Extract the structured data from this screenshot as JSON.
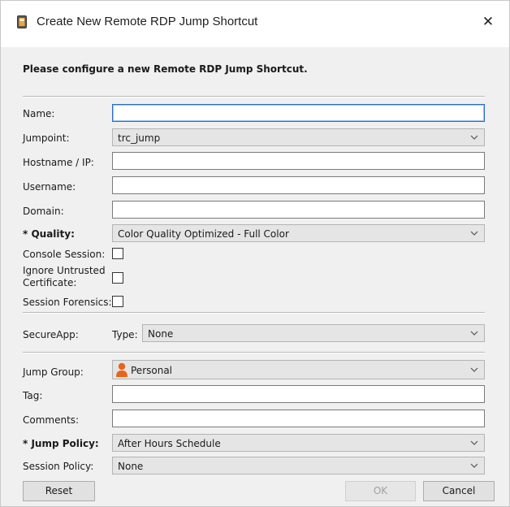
{
  "window": {
    "title": "Create New Remote RDP Jump Shortcut",
    "close_glyph": "✕"
  },
  "heading": "Please configure a new Remote RDP Jump Shortcut.",
  "fields": {
    "name": {
      "label": "Name:",
      "value": ""
    },
    "jumpoint": {
      "label": "Jumpoint:",
      "value": "trc_jump"
    },
    "hostname": {
      "label": "Hostname / IP:",
      "value": ""
    },
    "username": {
      "label": "Username:",
      "value": ""
    },
    "domain": {
      "label": "Domain:",
      "value": ""
    },
    "quality": {
      "label": "* Quality:",
      "value": "Color Quality Optimized - Full Color"
    },
    "console_session": {
      "label": "Console Session:",
      "checked": false
    },
    "ignore_cert": {
      "label_line1": "Ignore Untrusted",
      "label_line2": "Certificate:",
      "checked": false
    },
    "session_forensics": {
      "label": "Session Forensics:",
      "checked": false
    },
    "secureapp": {
      "label": "SecureApp:",
      "type_label": "Type:",
      "type_value": "None"
    },
    "jump_group": {
      "label": "Jump Group:",
      "value": "Personal",
      "icon": "person-icon"
    },
    "tag": {
      "label": "Tag:",
      "value": ""
    },
    "comments": {
      "label": "Comments:",
      "value": ""
    },
    "jump_policy": {
      "label": "* Jump Policy:",
      "value": "After Hours Schedule"
    },
    "session_policy": {
      "label": "Session Policy:",
      "value": "None"
    }
  },
  "buttons": {
    "reset": "Reset",
    "ok": "OK",
    "cancel": "Cancel"
  },
  "colors": {
    "focus_border": "#2a6cc4",
    "person_icon": "#e8641b"
  }
}
